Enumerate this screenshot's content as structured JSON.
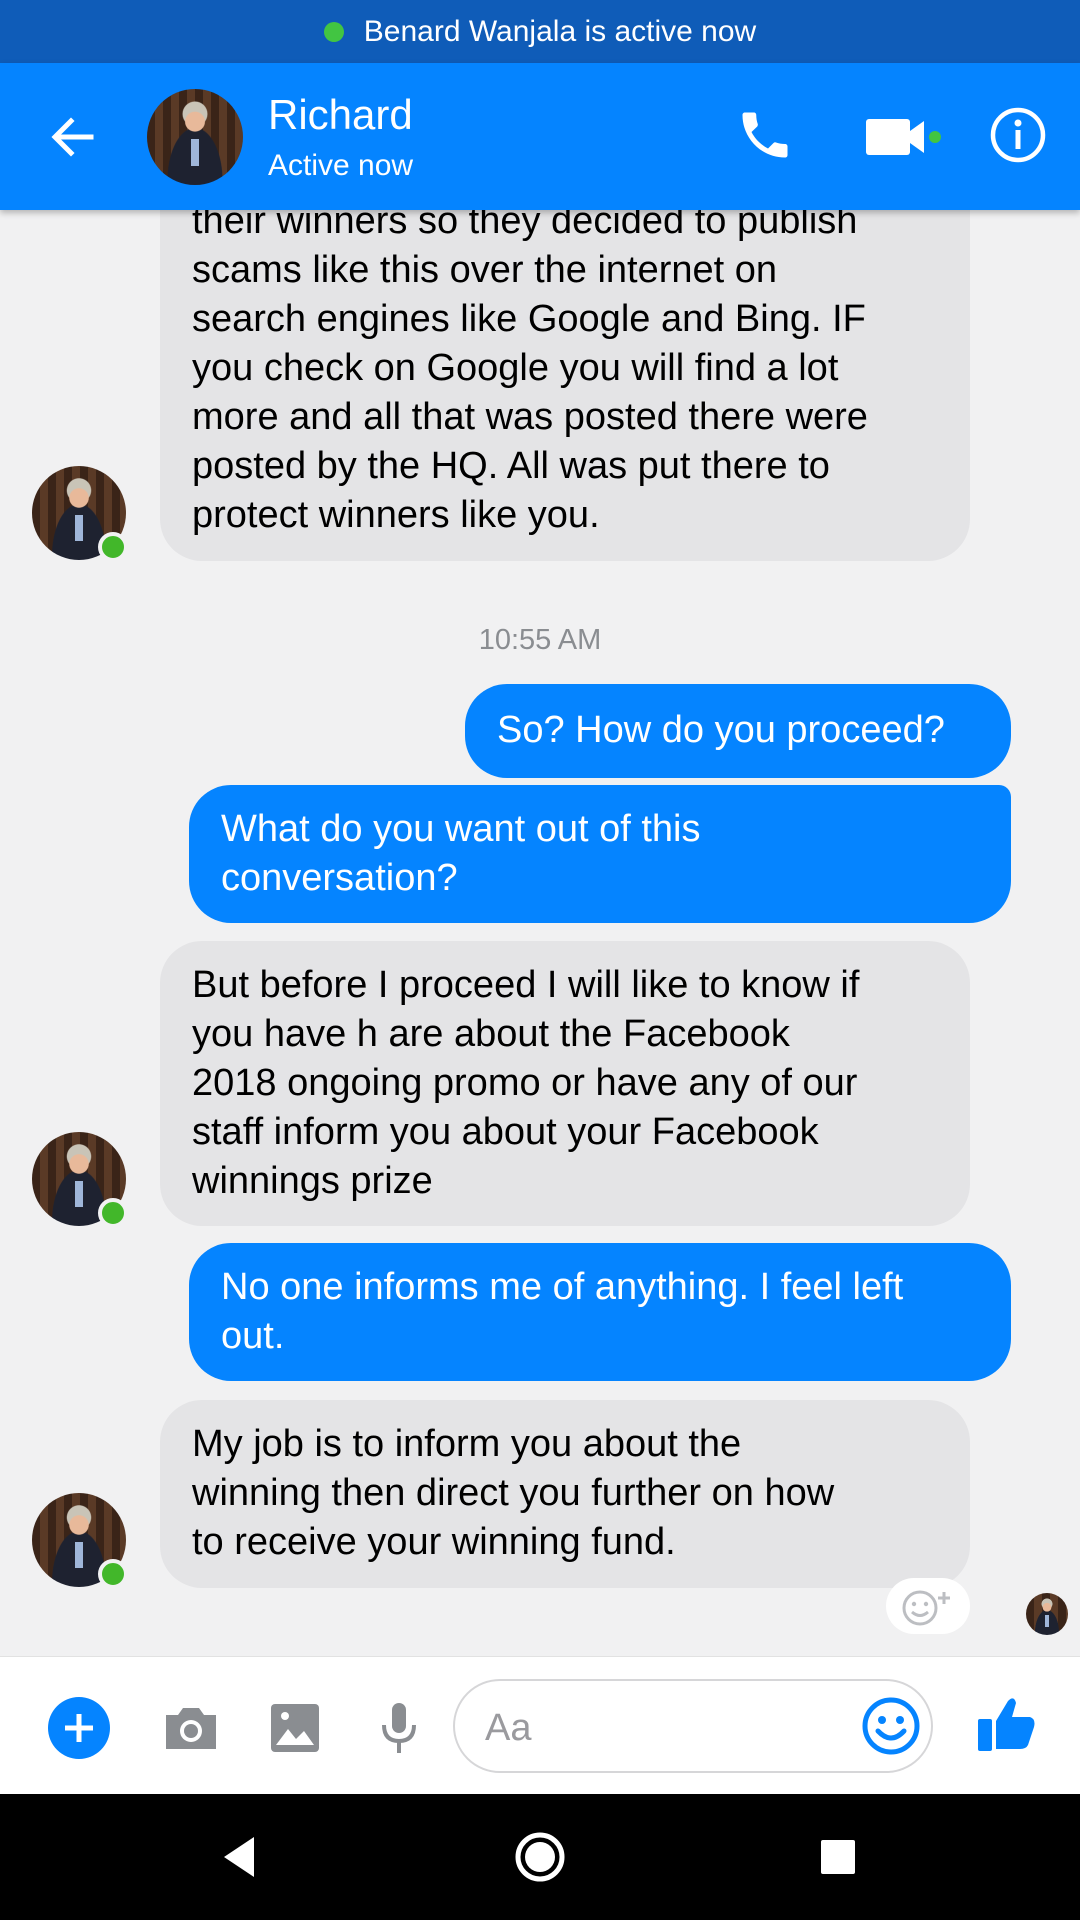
{
  "banner": {
    "text": "Benard Wanjala is active now"
  },
  "header": {
    "name": "Richard",
    "status": "Active now"
  },
  "colors": {
    "messenger_blue": "#0584ff",
    "banner_blue": "#0f5cb8",
    "online_green": "#42b72a",
    "incoming_bubble": "#e4e4e6"
  },
  "icons": {
    "back": "arrow-left-icon",
    "call": "phone-icon",
    "video": "video-camera-icon",
    "info": "info-icon",
    "add": "plus-circle-icon",
    "camera": "camera-icon",
    "gallery": "image-icon",
    "mic": "microphone-icon",
    "emoji": "smiley-icon",
    "like": "thumbs-up-icon",
    "react": "add-reaction-icon"
  },
  "messages": [
    {
      "direction": "in",
      "text": "their winners so they decided to publish\nscams like this over the internet on\nsearch engines like Google and Bing. IF\nyou check on Google you will find a lot\nmore and all that was posted there were\nposted by the HQ. All was put there to\nprotect winners like you."
    },
    {
      "direction": "out",
      "text": "So? How do you proceed?"
    },
    {
      "direction": "out",
      "text": "What do you want out of this\nconversation?"
    },
    {
      "direction": "in",
      "text": "But before I proceed I will like to know if\nyou have h are about the Facebook\n2018 ongoing promo or have any of our\nstaff inform you about your Facebook\nwinnings prize"
    },
    {
      "direction": "out",
      "text": "No one informs me of anything. I feel left\nout."
    },
    {
      "direction": "in",
      "text": "My job is to inform you about the\nwinning then direct you further on how\nto receive your winning fund."
    }
  ],
  "timestamp": "10:55 AM",
  "composer": {
    "placeholder": "Aa"
  }
}
